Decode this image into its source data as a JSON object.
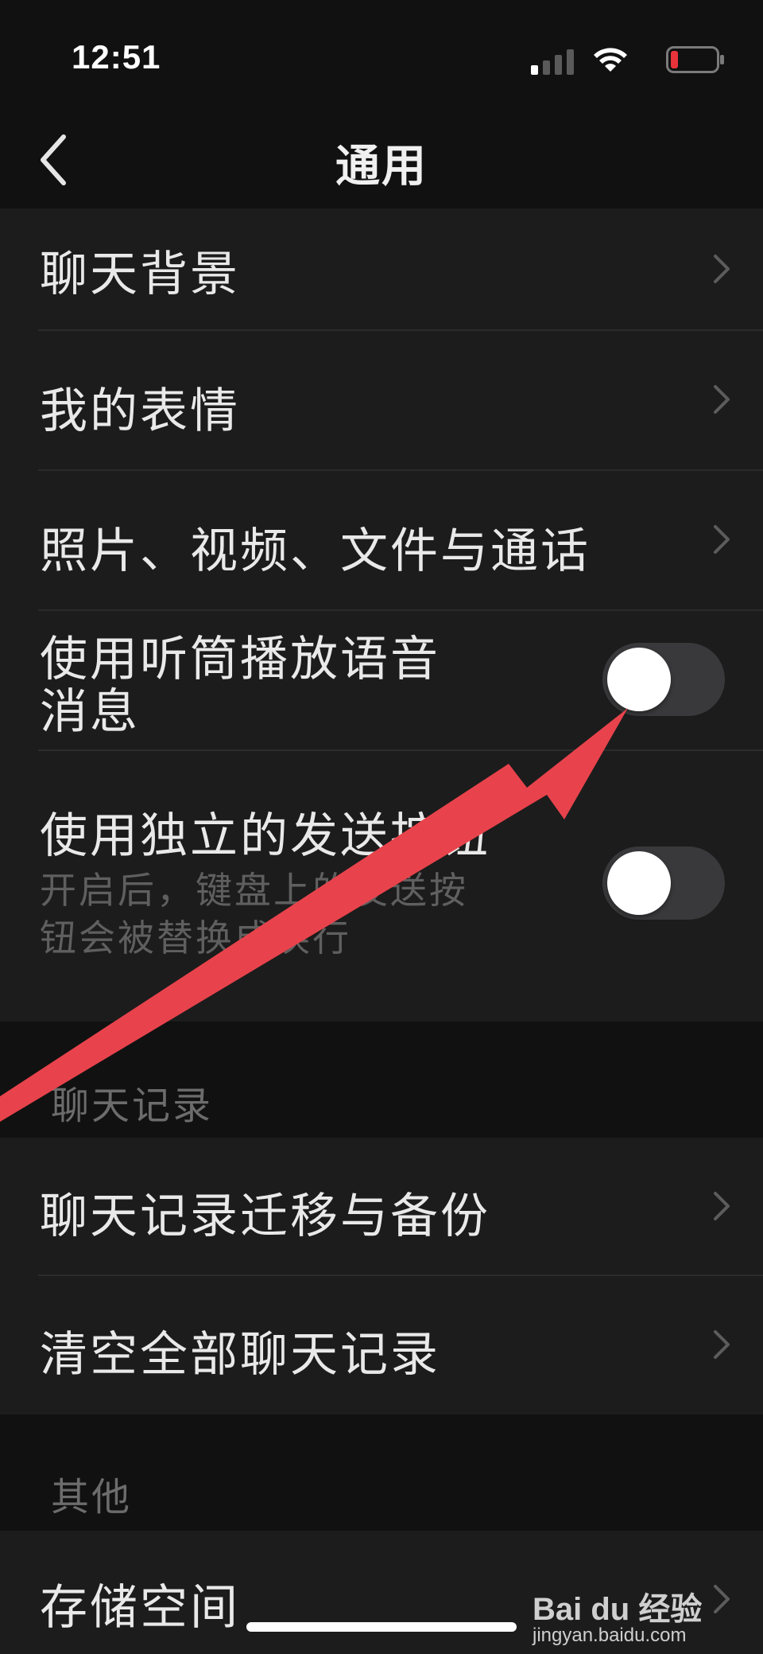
{
  "status_bar": {
    "time": "12:51",
    "signal_icon": "cellular-signal-icon",
    "wifi_icon": "wifi-icon",
    "battery_icon": "battery-low-icon",
    "battery_color": "#e8333b"
  },
  "nav": {
    "back_icon": "chevron-left-icon",
    "title": "通用"
  },
  "group_one": {
    "items": [
      {
        "label": "聊天背景",
        "accessory": "chevron-right-icon"
      },
      {
        "label": "我的表情",
        "accessory": "chevron-right-icon"
      },
      {
        "label": "照片、视频、文件与通话",
        "accessory": "chevron-right-icon"
      },
      {
        "label_line1": "使用听筒播放语音",
        "label_line2": "消息",
        "toggle_on": false
      },
      {
        "label": "使用独立的发送按钮",
        "sub_line1": "开启后，键盘上的发送按",
        "sub_line2": "钮会被替换成换行",
        "toggle_on": false
      }
    ]
  },
  "section_chat_history": {
    "header": "聊天记录",
    "items": [
      {
        "label": "聊天记录迁移与备份",
        "accessory": "chevron-right-icon"
      },
      {
        "label": "清空全部聊天记录",
        "accessory": "chevron-right-icon"
      }
    ]
  },
  "section_other": {
    "header": "其他",
    "items": [
      {
        "label": "存储空间",
        "accessory": "chevron-right-icon"
      }
    ]
  },
  "annotation": {
    "arrow_color": "#e8434c"
  },
  "watermark": {
    "logo_text": "Bai du 经验",
    "url": "jingyan.baidu.com"
  },
  "colors": {
    "background": "#111111",
    "cell": "#1c1c1c",
    "toggle_off": "#39393b"
  }
}
